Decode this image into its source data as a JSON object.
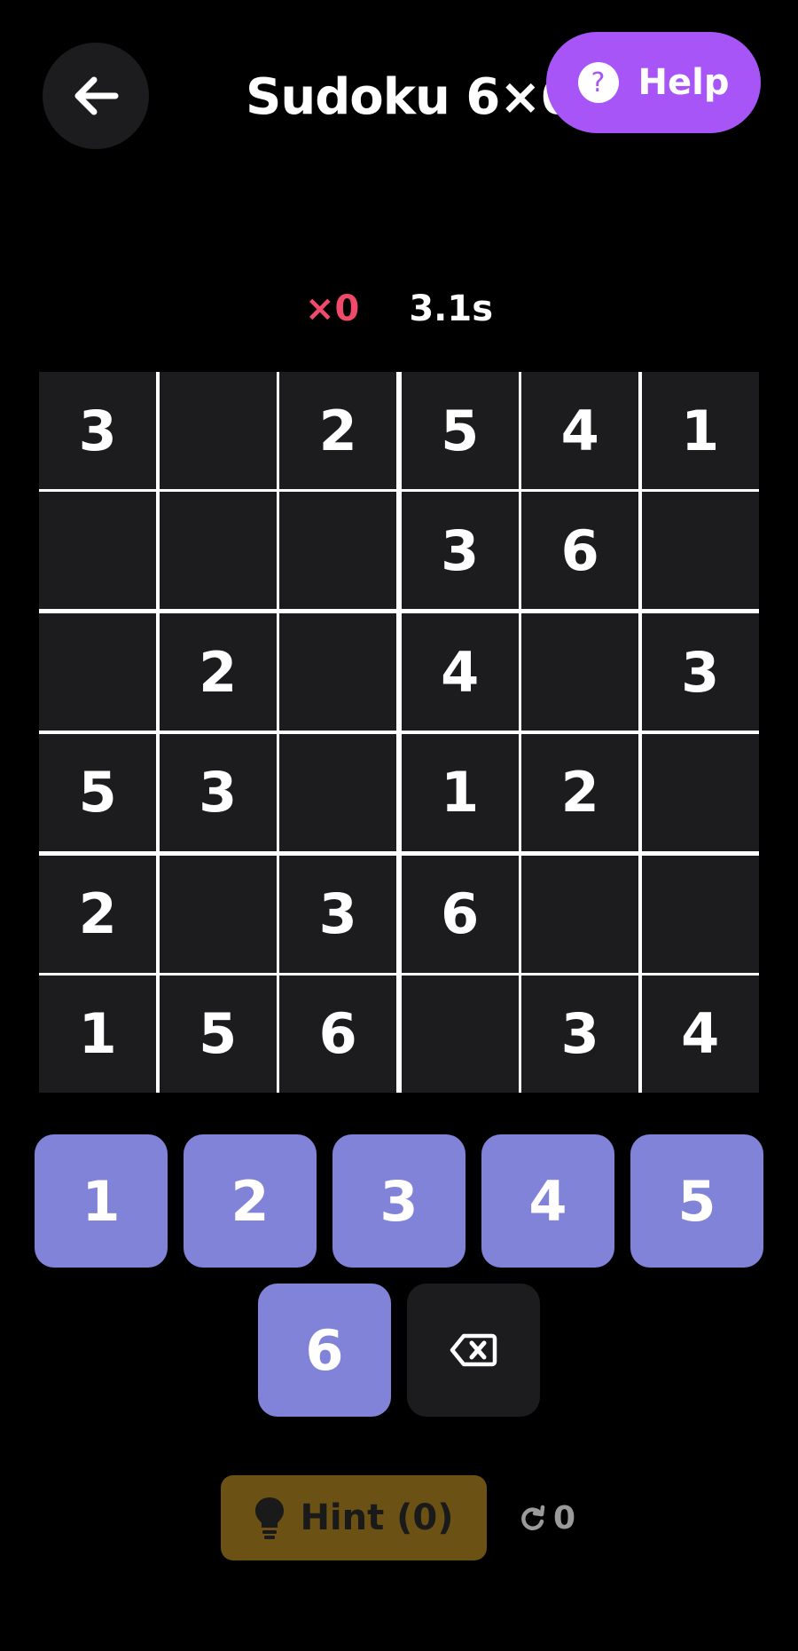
{
  "header": {
    "back_icon": "arrow-left-icon",
    "title": "Sudoku 6×6",
    "help_icon": "question-circle-icon",
    "help_label": "Help",
    "help_color": "#a855f7"
  },
  "stats": {
    "mistakes": "×0",
    "timer": "3.1s",
    "mistakes_color": "#ef4a6a"
  },
  "board": {
    "size": 6,
    "box_rows": 2,
    "box_cols": 3,
    "cells": [
      [
        "3",
        "",
        "2",
        "5",
        "4",
        "1"
      ],
      [
        "",
        "",
        "",
        "3",
        "6",
        ""
      ],
      [
        "",
        "2",
        "",
        "4",
        "",
        "3"
      ],
      [
        "5",
        "3",
        "",
        "1",
        "2",
        ""
      ],
      [
        "2",
        "",
        "3",
        "6",
        "",
        ""
      ],
      [
        "1",
        "5",
        "6",
        "",
        "3",
        "4"
      ]
    ]
  },
  "keypad": {
    "keys": [
      "1",
      "2",
      "3",
      "4",
      "5",
      "6"
    ],
    "delete_icon": "backspace-icon",
    "key_color": "#8183d8"
  },
  "footer": {
    "hint_icon": "lightbulb-icon",
    "hint_label": "Hint (0)",
    "hint_color": "#6b5214",
    "undo_icon": "redo-arrow-icon",
    "undo_count": "0"
  }
}
